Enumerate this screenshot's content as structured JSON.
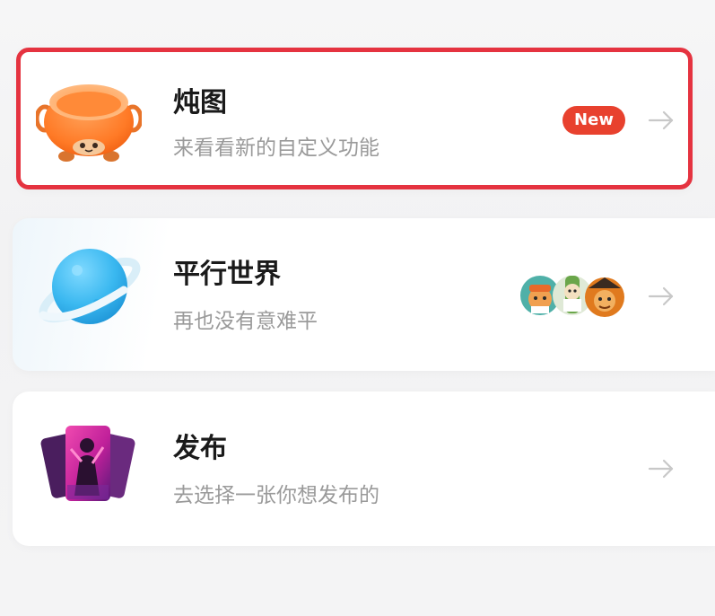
{
  "items": [
    {
      "title": "炖图",
      "subtitle": "来看看新的自定义功能",
      "badge": "New",
      "icon": "stew-pot-icon",
      "arrow": "arrow-right-icon",
      "highlighted": true
    },
    {
      "title": "平行世界",
      "subtitle": "再也没有意难平",
      "icon": "planet-icon",
      "arrow": "arrow-right-icon",
      "avatars": [
        "avatar",
        "avatar",
        "avatar"
      ]
    },
    {
      "title": "发布",
      "subtitle": "去选择一张你想发布的",
      "icon": "card-stack-icon",
      "arrow": "arrow-right-icon"
    }
  ],
  "colors": {
    "background": "#f3f3f4",
    "card": "#ffffff",
    "highlight_border": "#e53340",
    "badge": "#e8412e",
    "title": "#1a1a1a",
    "subtitle": "#9a9a9a",
    "arrow": "#c8c8c8"
  }
}
